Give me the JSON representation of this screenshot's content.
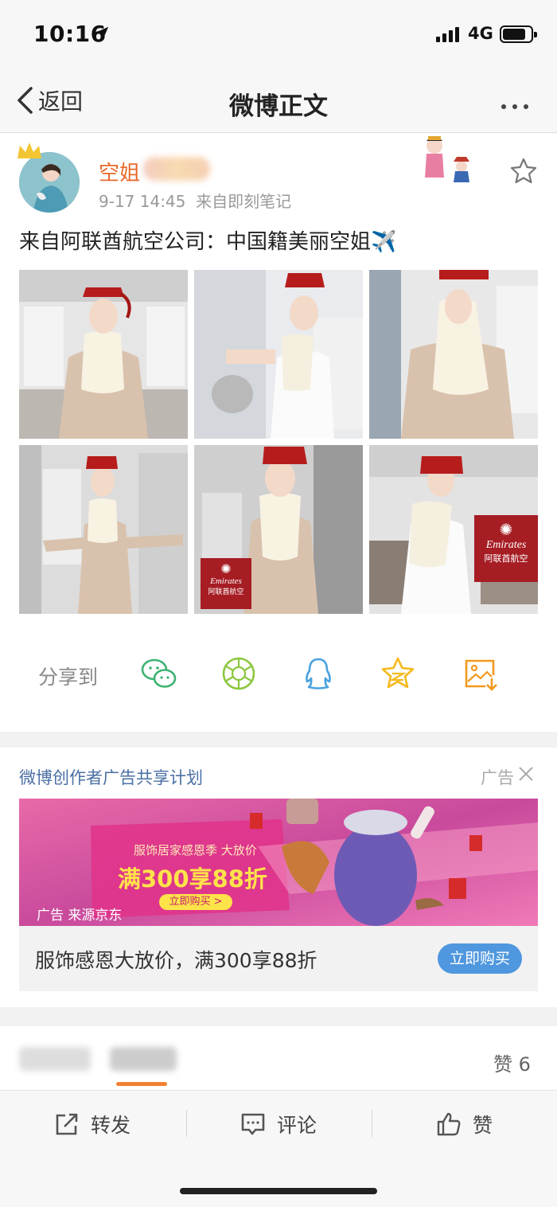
{
  "status": {
    "time": "10:16",
    "network": "4G"
  },
  "nav": {
    "back_label": "返回",
    "title": "微博正文"
  },
  "post": {
    "username": "空姐",
    "time": "9-17 14:45",
    "source": "来自即刻笔记",
    "text": "来自阿联酋航空公司：中国籍美丽空姐",
    "text_emoji": "✈️",
    "watermark_brand": "Emirates",
    "watermark_cn": "阿联酋航空",
    "share_label": "分享到",
    "share_icons": [
      "wechat-icon",
      "moments-icon",
      "qq-icon",
      "qzone-icon",
      "save-image-icon"
    ]
  },
  "ad": {
    "title": "微博创作者广告共享计划",
    "tag": "广告",
    "banner_line1": "服饰居家感恩季 大放价",
    "banner_line2": "满300享88折",
    "banner_button": "立即购买 >",
    "banner_source": "广告 来源京东",
    "caption": "服饰感恩大放价，满300享88折",
    "buy_label": "立即购买"
  },
  "tabs": {
    "likes_label": "赞 6"
  },
  "actions": {
    "repost": "转发",
    "comment": "评论",
    "like": "赞"
  },
  "colors": {
    "accent_orange": "#e8692b",
    "link_blue": "#4a6fa5",
    "button_blue": "#4f97de",
    "tab_underline": "#f08232"
  }
}
